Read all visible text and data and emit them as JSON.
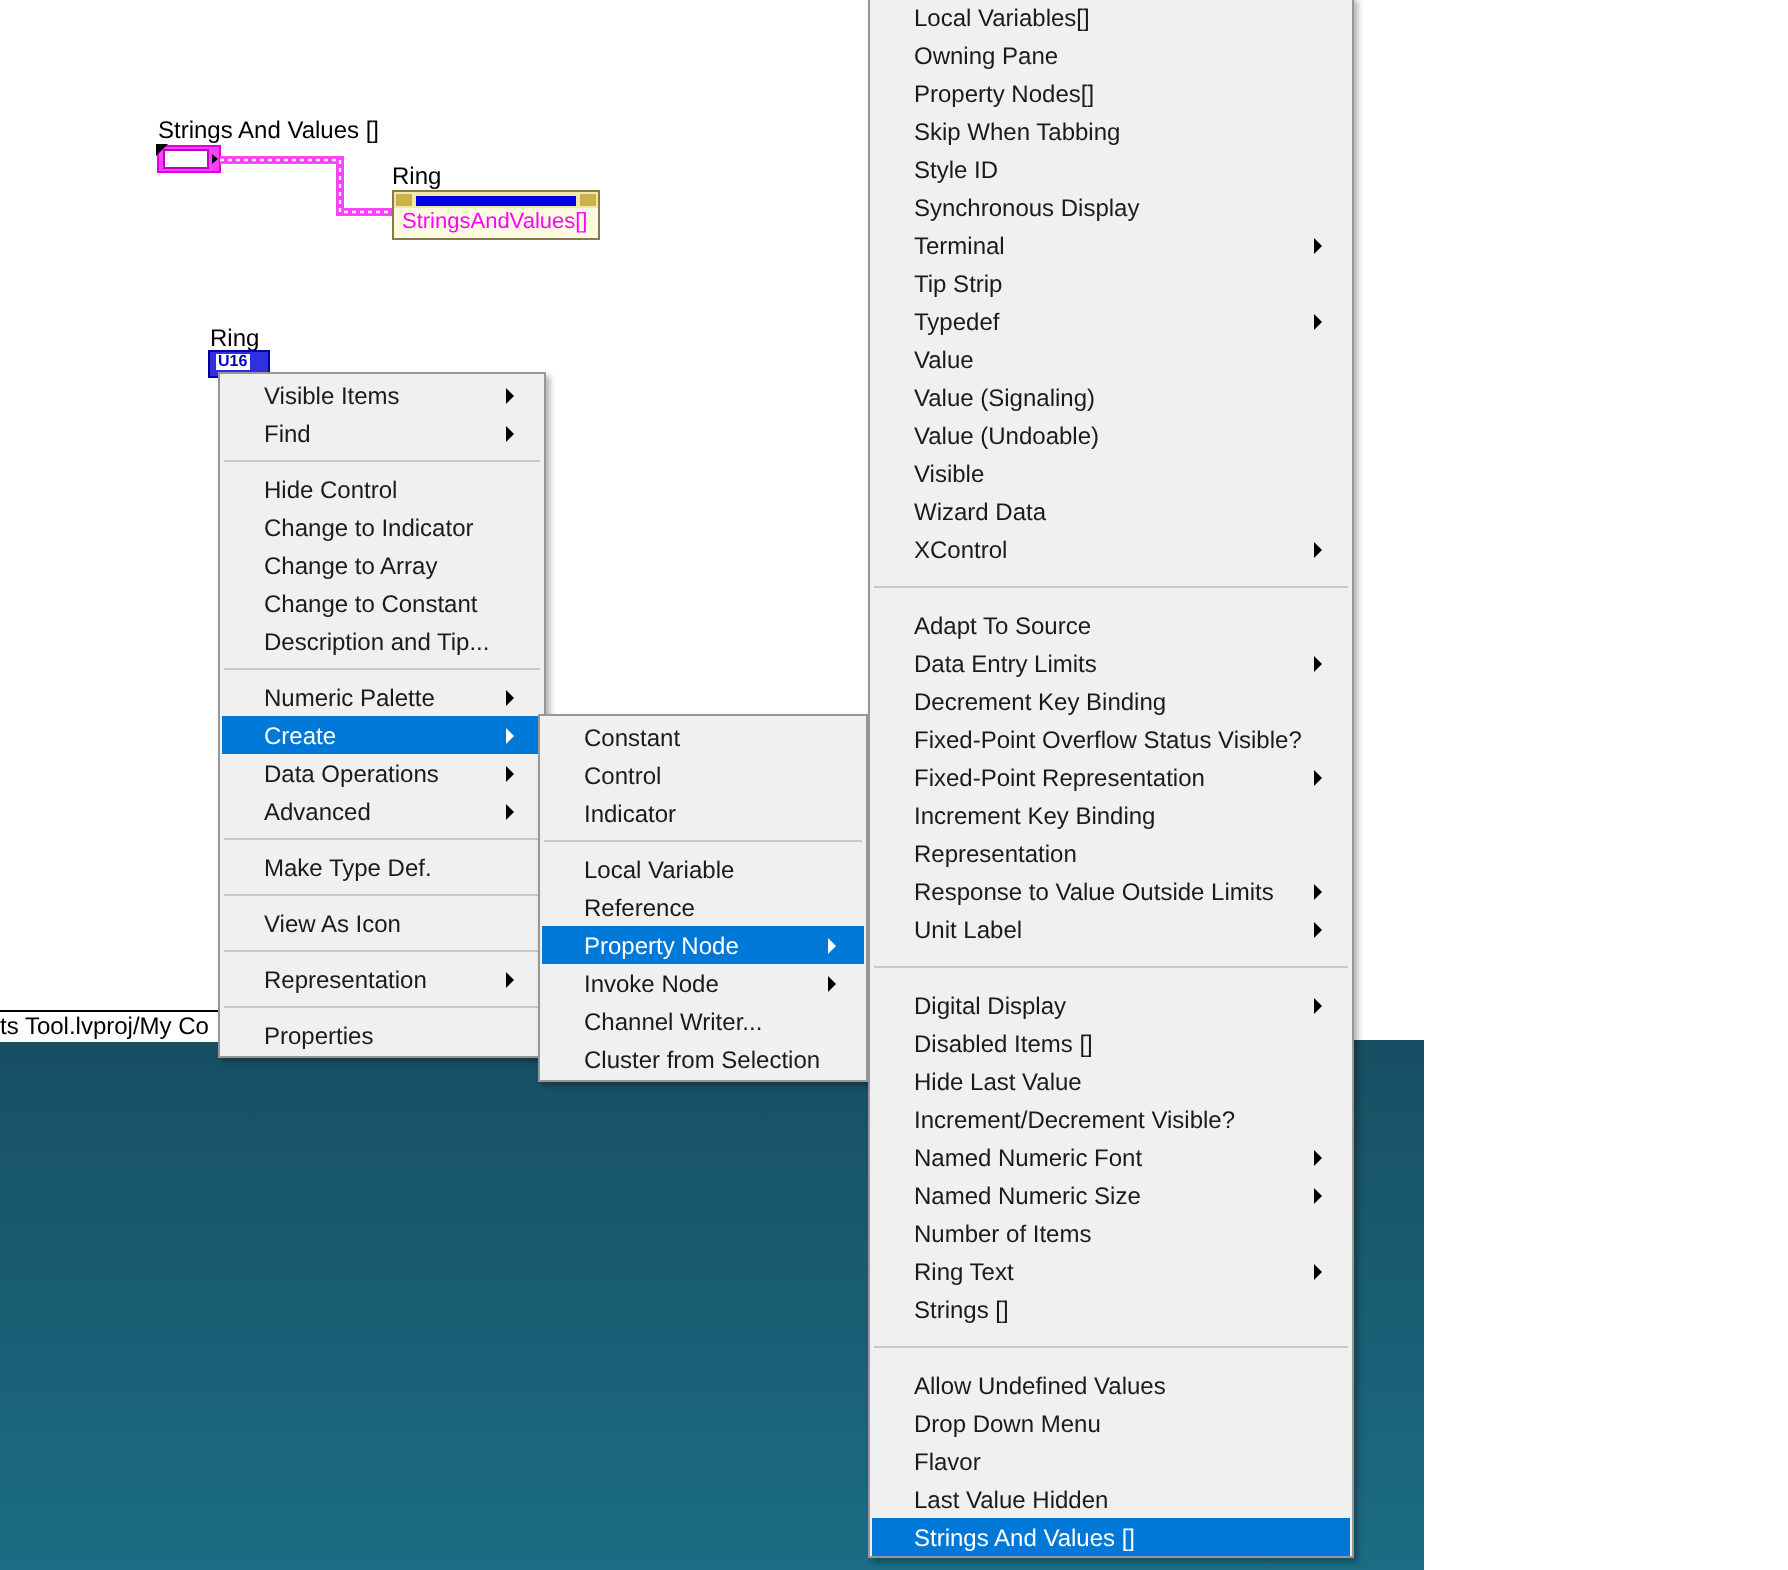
{
  "diagram": {
    "array_label": "Strings And Values []",
    "property_node": {
      "label": "Ring",
      "property": "StringsAndValues[]"
    },
    "ring_label": "Ring",
    "ring_terminal": "U16"
  },
  "status_bar": {
    "path": "ts Tool.lvproj/My Co"
  },
  "menus": [
    {
      "items": [
        {
          "kind": "item",
          "label": "Visible Items",
          "submenu": true,
          "selected": false
        },
        {
          "kind": "item",
          "label": "Find",
          "submenu": true,
          "selected": false
        },
        {
          "kind": "separator"
        },
        {
          "kind": "item",
          "label": "Hide Control",
          "submenu": false,
          "selected": false
        },
        {
          "kind": "item",
          "label": "Change to Indicator",
          "submenu": false,
          "selected": false
        },
        {
          "kind": "item",
          "label": "Change to Array",
          "submenu": false,
          "selected": false
        },
        {
          "kind": "item",
          "label": "Change to Constant",
          "submenu": false,
          "selected": false
        },
        {
          "kind": "item",
          "label": "Description and Tip...",
          "submenu": false,
          "selected": false
        },
        {
          "kind": "separator"
        },
        {
          "kind": "item",
          "label": "Numeric Palette",
          "submenu": true,
          "selected": false
        },
        {
          "kind": "item",
          "label": "Create",
          "submenu": true,
          "selected": true
        },
        {
          "kind": "item",
          "label": "Data Operations",
          "submenu": true,
          "selected": false
        },
        {
          "kind": "item",
          "label": "Advanced",
          "submenu": true,
          "selected": false
        },
        {
          "kind": "separator"
        },
        {
          "kind": "item",
          "label": "Make Type Def.",
          "submenu": false,
          "selected": false
        },
        {
          "kind": "separator"
        },
        {
          "kind": "item",
          "label": "View As Icon",
          "submenu": false,
          "selected": false
        },
        {
          "kind": "separator"
        },
        {
          "kind": "item",
          "label": "Representation",
          "submenu": true,
          "selected": false
        },
        {
          "kind": "separator"
        },
        {
          "kind": "item",
          "label": "Properties",
          "submenu": false,
          "selected": false
        }
      ]
    },
    {
      "items": [
        {
          "kind": "item",
          "label": "Constant",
          "submenu": false,
          "selected": false
        },
        {
          "kind": "item",
          "label": "Control",
          "submenu": false,
          "selected": false
        },
        {
          "kind": "item",
          "label": "Indicator",
          "submenu": false,
          "selected": false
        },
        {
          "kind": "separator"
        },
        {
          "kind": "item",
          "label": "Local Variable",
          "submenu": false,
          "selected": false
        },
        {
          "kind": "item",
          "label": "Reference",
          "submenu": false,
          "selected": false
        },
        {
          "kind": "item",
          "label": "Property Node",
          "submenu": true,
          "selected": true
        },
        {
          "kind": "item",
          "label": "Invoke Node",
          "submenu": true,
          "selected": false
        },
        {
          "kind": "item",
          "label": "Channel Writer...",
          "submenu": false,
          "selected": false
        },
        {
          "kind": "item",
          "label": "Cluster from Selection",
          "submenu": false,
          "selected": false
        }
      ]
    },
    {
      "items": [
        {
          "kind": "item",
          "label": "Local Variables[]",
          "submenu": false,
          "selected": false
        },
        {
          "kind": "item",
          "label": "Owning Pane",
          "submenu": false,
          "selected": false
        },
        {
          "kind": "item",
          "label": "Property Nodes[]",
          "submenu": false,
          "selected": false
        },
        {
          "kind": "item",
          "label": "Skip When Tabbing",
          "submenu": false,
          "selected": false
        },
        {
          "kind": "item",
          "label": "Style ID",
          "submenu": false,
          "selected": false
        },
        {
          "kind": "item",
          "label": "Synchronous Display",
          "submenu": false,
          "selected": false
        },
        {
          "kind": "item",
          "label": "Terminal",
          "submenu": true,
          "selected": false
        },
        {
          "kind": "item",
          "label": "Tip Strip",
          "submenu": false,
          "selected": false
        },
        {
          "kind": "item",
          "label": "Typedef",
          "submenu": true,
          "selected": false
        },
        {
          "kind": "item",
          "label": "Value",
          "submenu": false,
          "selected": false
        },
        {
          "kind": "item",
          "label": "Value (Signaling)",
          "submenu": false,
          "selected": false
        },
        {
          "kind": "item",
          "label": "Value (Undoable)",
          "submenu": false,
          "selected": false
        },
        {
          "kind": "item",
          "label": "Visible",
          "submenu": false,
          "selected": false
        },
        {
          "kind": "item",
          "label": "Wizard Data",
          "submenu": false,
          "selected": false
        },
        {
          "kind": "item",
          "label": "XControl",
          "submenu": true,
          "selected": false
        },
        {
          "kind": "separator"
        },
        {
          "kind": "item",
          "label": "Adapt To Source",
          "submenu": false,
          "selected": false
        },
        {
          "kind": "item",
          "label": "Data Entry Limits",
          "submenu": true,
          "selected": false
        },
        {
          "kind": "item",
          "label": "Decrement Key Binding",
          "submenu": false,
          "selected": false
        },
        {
          "kind": "item",
          "label": "Fixed-Point Overflow Status Visible?",
          "submenu": false,
          "selected": false
        },
        {
          "kind": "item",
          "label": "Fixed-Point Representation",
          "submenu": true,
          "selected": false
        },
        {
          "kind": "item",
          "label": "Increment Key Binding",
          "submenu": false,
          "selected": false
        },
        {
          "kind": "item",
          "label": "Representation",
          "submenu": false,
          "selected": false
        },
        {
          "kind": "item",
          "label": "Response to Value Outside Limits",
          "submenu": true,
          "selected": false
        },
        {
          "kind": "item",
          "label": "Unit Label",
          "submenu": true,
          "selected": false
        },
        {
          "kind": "separator"
        },
        {
          "kind": "item",
          "label": "Digital Display",
          "submenu": true,
          "selected": false
        },
        {
          "kind": "item",
          "label": "Disabled Items []",
          "submenu": false,
          "selected": false
        },
        {
          "kind": "item",
          "label": "Hide Last Value",
          "submenu": false,
          "selected": false
        },
        {
          "kind": "item",
          "label": "Increment/Decrement Visible?",
          "submenu": false,
          "selected": false
        },
        {
          "kind": "item",
          "label": "Named Numeric Font",
          "submenu": true,
          "selected": false
        },
        {
          "kind": "item",
          "label": "Named Numeric Size",
          "submenu": true,
          "selected": false
        },
        {
          "kind": "item",
          "label": "Number of Items",
          "submenu": false,
          "selected": false
        },
        {
          "kind": "item",
          "label": "Ring Text",
          "submenu": true,
          "selected": false
        },
        {
          "kind": "item",
          "label": "Strings []",
          "submenu": false,
          "selected": false
        },
        {
          "kind": "separator"
        },
        {
          "kind": "item",
          "label": "Allow Undefined Values",
          "submenu": false,
          "selected": false
        },
        {
          "kind": "item",
          "label": "Drop Down Menu",
          "submenu": false,
          "selected": false
        },
        {
          "kind": "item",
          "label": "Flavor",
          "submenu": false,
          "selected": false
        },
        {
          "kind": "item",
          "label": "Last Value Hidden",
          "submenu": false,
          "selected": false
        },
        {
          "kind": "item",
          "label": "Strings And Values []",
          "submenu": false,
          "selected": true
        }
      ]
    }
  ]
}
